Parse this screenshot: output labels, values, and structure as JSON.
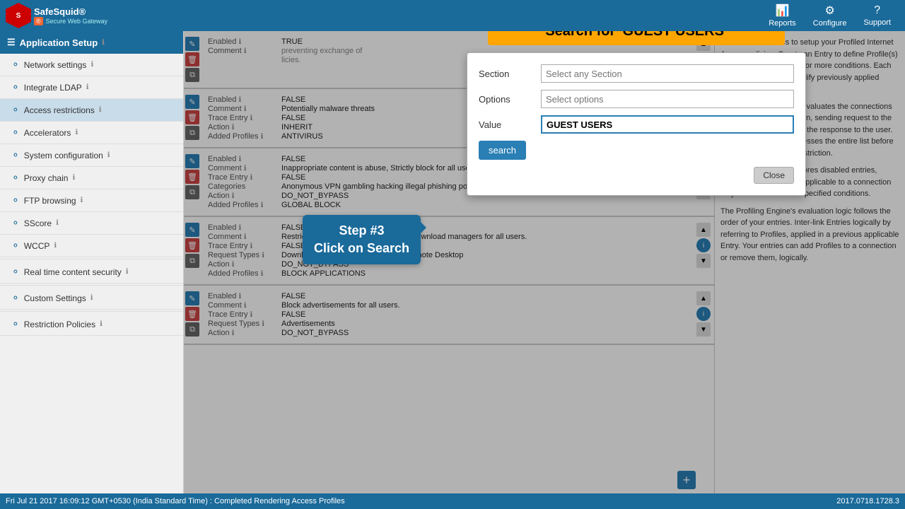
{
  "header": {
    "logo_name": "SafeSquid®",
    "logo_sub": "Secure Web Gateway",
    "nav": [
      {
        "label": "Reports",
        "icon": "📊"
      },
      {
        "label": "Configure",
        "icon": "⚙"
      },
      {
        "label": "Support",
        "icon": "?"
      }
    ]
  },
  "sidebar": {
    "app_setup_label": "Application Setup",
    "items": [
      {
        "label": "Network settings",
        "icon": "≡"
      },
      {
        "label": "Integrate LDAP",
        "icon": "≡"
      },
      {
        "label": "Access restrictions",
        "icon": "≡"
      },
      {
        "label": "Accelerators",
        "icon": "≡"
      },
      {
        "label": "System configuration",
        "icon": "≡"
      },
      {
        "label": "Proxy chain",
        "icon": "≡"
      },
      {
        "label": "FTP browsing",
        "icon": "≡"
      },
      {
        "label": "SScore",
        "icon": "≡"
      },
      {
        "label": "WCCP",
        "icon": "≡"
      },
      {
        "label": "Real time content security",
        "icon": "≡"
      },
      {
        "label": "Custom Settings",
        "icon": "≡"
      },
      {
        "label": "Restriction Policies",
        "icon": "≡"
      }
    ]
  },
  "modal": {
    "title": "Search for 'GUEST USERS'",
    "section_label": "Section",
    "section_placeholder": "Select any Section",
    "options_label": "Options",
    "options_placeholder": "Select options",
    "value_label": "Value",
    "value_input": "GUEST USERS",
    "search_btn": "search",
    "close_btn": "Close"
  },
  "callout": {
    "step": "Step #3",
    "action": "Click on Search"
  },
  "data_rows": [
    {
      "enabled": "TRUE",
      "comment": "",
      "trace_entry": "",
      "action": "",
      "added_profiles": ""
    },
    {
      "enabled": "FALSE",
      "comment": "Potentially malware threats",
      "trace_entry": "FALSE",
      "action": "INHERIT",
      "added_profiles": "ANTIVIRUS"
    },
    {
      "enabled": "FALSE",
      "comment": "Inappropriate content is abuse, Strictly block for all users.",
      "trace_entry": "FALSE",
      "categories": "Anonymous VPN  gambling  hacking  illegal  phishing  pornography  violence  virusinfected  webproxy",
      "action": "DO_NOT_BYPASS",
      "added_profiles": "GLOBAL BLOCK"
    },
    {
      "enabled": "FALSE",
      "comment": "Restrict remote desktop applications ,Download managers for all users.",
      "trace_entry": "FALSE",
      "request_types": "Download Manager  Online Meeting  Remote Desktop",
      "action": "DO_NOT_BYPASS",
      "added_profiles": "BLOCK APPLICATIONS"
    },
    {
      "enabled": "FALSE",
      "comment": "Block advertisements for all users.",
      "trace_entry": "FALSE",
      "request_types": "Advertisements",
      "action": "DO_NOT_BYPASS"
    }
  ],
  "info_panel": {
    "paragraphs": [
      "Use Access Profiles to setup your Profiled Internet Access policies. Create an Entry to define Profile(s) as a combination of one or more conditions. Each entry may optionally modify previously applied restrictions, or Profile(s).",
      "The Profiling Engine re-evaluates the connections before user authentication, sending request to the web server, and sending the response to the user. Each re-evaluation processes the entire list before affecting the resultant restriction.",
      "The Profiling Engine ignores disabled entries, intelligently. An entry is applicable to a connection only if it meets ALL the specified conditions.",
      "The Profiling Engine's evaluation logic follows the order of your entries. Inter-link Entries logically by referring to Profiles, applied in a previous applicable Entry. Your entries can add Profiles to a connection or remove them, logically."
    ]
  },
  "status_bar": {
    "message": "Fri Jul 21 2017 16:09:12 GMT+0530 (India Standard Time) : Completed Rendering Access Profiles",
    "version": "2017.0718.1728.3"
  },
  "add_button_label": "+"
}
